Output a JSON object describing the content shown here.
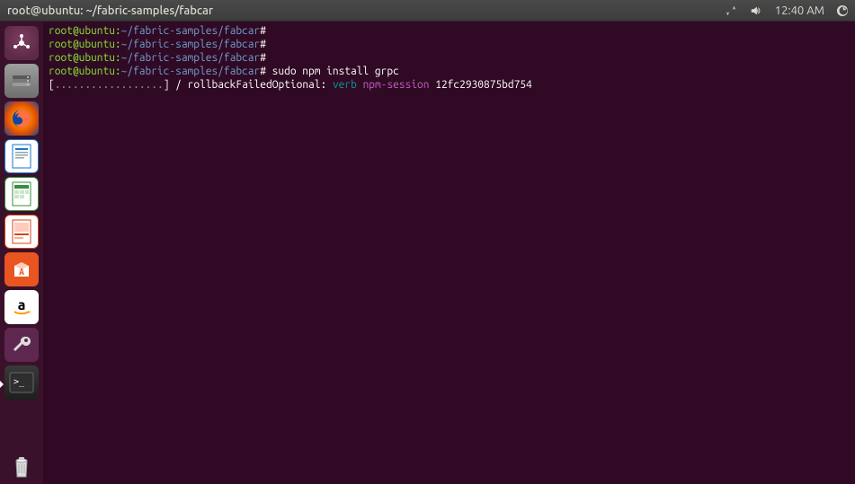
{
  "menubar": {
    "title": "root@ubuntu: ~/fabric-samples/fabcar",
    "time": "12:40 AM"
  },
  "terminal": {
    "prompt_user_host": "root@ubuntu:",
    "prompt_path": "~/fabric-samples/fabcar",
    "prompt_symbol": "#",
    "line1_cmd": "",
    "line2_cmd": "",
    "line3_cmd": "",
    "line4_cmd": "sudo npm install grpc",
    "progress_open": "[",
    "progress_dots": "..................",
    "progress_close": "]",
    "spinner": "/",
    "rollback": "rollbackFailedOptional:",
    "verb": "verb",
    "session": "npm-session",
    "hash": "12fc2930875bd754"
  },
  "launcher": {
    "items": [
      {
        "name": "dash",
        "label": "Dash"
      },
      {
        "name": "files",
        "label": "Files"
      },
      {
        "name": "firefox",
        "label": "Firefox"
      },
      {
        "name": "writer",
        "label": "LibreOffice Writer"
      },
      {
        "name": "calc",
        "label": "LibreOffice Calc"
      },
      {
        "name": "impress",
        "label": "LibreOffice Impress"
      },
      {
        "name": "software",
        "label": "Ubuntu Software"
      },
      {
        "name": "amazon",
        "label": "Amazon"
      },
      {
        "name": "settings",
        "label": "System Settings"
      },
      {
        "name": "terminal",
        "label": "Terminal"
      },
      {
        "name": "trash",
        "label": "Trash"
      }
    ]
  }
}
